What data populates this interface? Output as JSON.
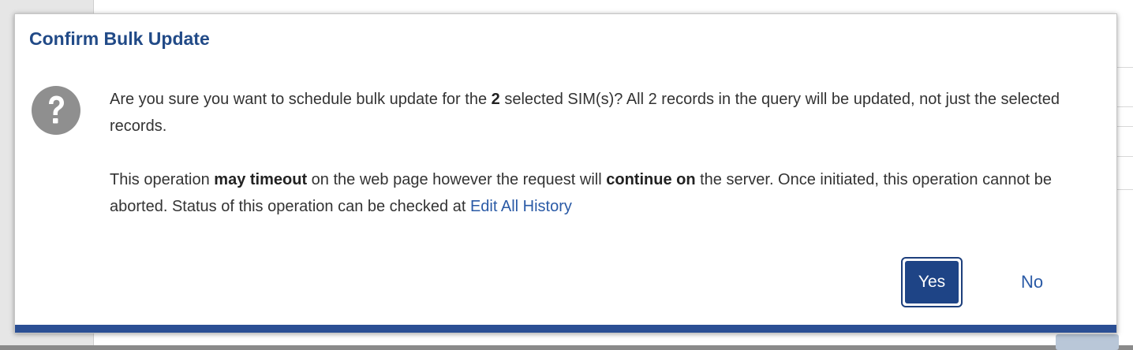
{
  "dialog": {
    "title": "Confirm Bulk Update",
    "message1_part1": "Are you sure you want to schedule bulk update for the ",
    "message1_count": "2",
    "message1_part2": " selected SIM(s)? All 2 records in the query will be updated, not just the selected records.",
    "message2_part1": "This operation ",
    "message2_bold1": "may timeout",
    "message2_part2": " on the web page however the request will ",
    "message2_bold2": "continue on",
    "message2_part3": " the server. Once initiated, this operation cannot be aborted. Status of this operation can be checked at ",
    "history_link": "Edit All History",
    "yes_label": "Yes",
    "no_label": "No"
  },
  "colors": {
    "title": "#214a87",
    "primary_button": "#1e4486",
    "link": "#2a5aa6",
    "accent_bar": "#2b4f94"
  },
  "icons": {
    "question": "question-circle-icon"
  }
}
